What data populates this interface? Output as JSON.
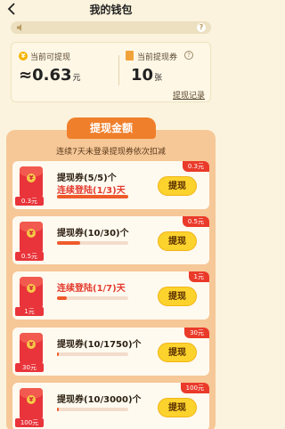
{
  "header": {
    "title": "我的钱包",
    "help_icon": "?"
  },
  "balance": {
    "withdrawable_label": "当前可提现",
    "amount": "≈0.63",
    "amount_unit": "元",
    "ticket_label": "当前提现券",
    "ticket_count": "10",
    "ticket_unit": "张",
    "help": "?",
    "record_link": "提现记录"
  },
  "panel": {
    "title": "提现金额",
    "subtitle": "连续7天未登录提现券依次扣减"
  },
  "tasks": [
    {
      "amount_tag": "0.3元",
      "envelope_amount": "0.3元",
      "title": "提现券(5/5)个",
      "subtitle": "连续登陆(1/3)天",
      "progress": 1.0,
      "button": "提现"
    },
    {
      "amount_tag": "0.5元",
      "envelope_amount": "0.5元",
      "title": "提现券(10/30)个",
      "subtitle": "",
      "progress": 0.33,
      "button": "提现"
    },
    {
      "amount_tag": "1元",
      "envelope_amount": "1元",
      "title": "",
      "subtitle": "连续登陆(1/7)天",
      "progress": 0.14,
      "button": "提现"
    },
    {
      "amount_tag": "30元",
      "envelope_amount": "30元",
      "title": "提现券(10/1750)个",
      "subtitle": "",
      "progress": 0.01,
      "button": "提现"
    },
    {
      "amount_tag": "100元",
      "envelope_amount": "100元",
      "title": "提现券(10/3000)个",
      "subtitle": "",
      "progress": 0.003,
      "button": "提现"
    }
  ],
  "envelope_coin": "¥",
  "colors": {
    "accent": "#ef7f2b",
    "button": "#fcd22d",
    "badge": "#ea3a2a"
  }
}
